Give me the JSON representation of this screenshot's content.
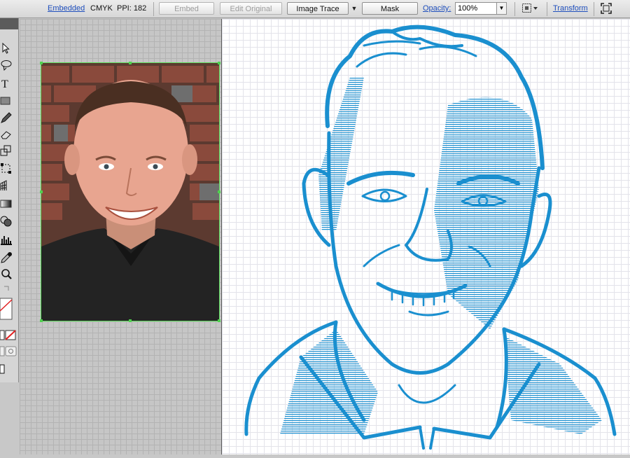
{
  "control_bar": {
    "embedded_link": "Embedded",
    "color_mode": "CMYK",
    "ppi_label": "PPI: 182",
    "embed_button": "Embed",
    "edit_original_button": "Edit Original",
    "image_trace_button": "Image Trace",
    "mask_button": "Mask",
    "opacity_label": "Opacity:",
    "opacity_value": "100%",
    "transform_link": "Transform"
  },
  "colors": {
    "accent_link": "#1f4fbd",
    "trace_blue": "#1a8fcf",
    "selection_green": "#4fd14f"
  },
  "icons": [
    "selection-tool-icon",
    "lasso-tool-icon",
    "type-tool-icon",
    "rectangle-tool-icon",
    "pencil-tool-icon",
    "eraser-tool-icon",
    "scale-tool-icon",
    "free-transform-icon",
    "perspective-grid-icon",
    "gradient-tool-icon",
    "blend-tool-icon",
    "graph-tool-icon",
    "eyedropper-icon",
    "zoom-tool-icon",
    "swap-colors-icon",
    "fill-stroke-icon",
    "none-swatch-icon",
    "draw-mode-icon",
    "screen-mode-icon",
    "align-icon",
    "fullscreen-icon"
  ]
}
